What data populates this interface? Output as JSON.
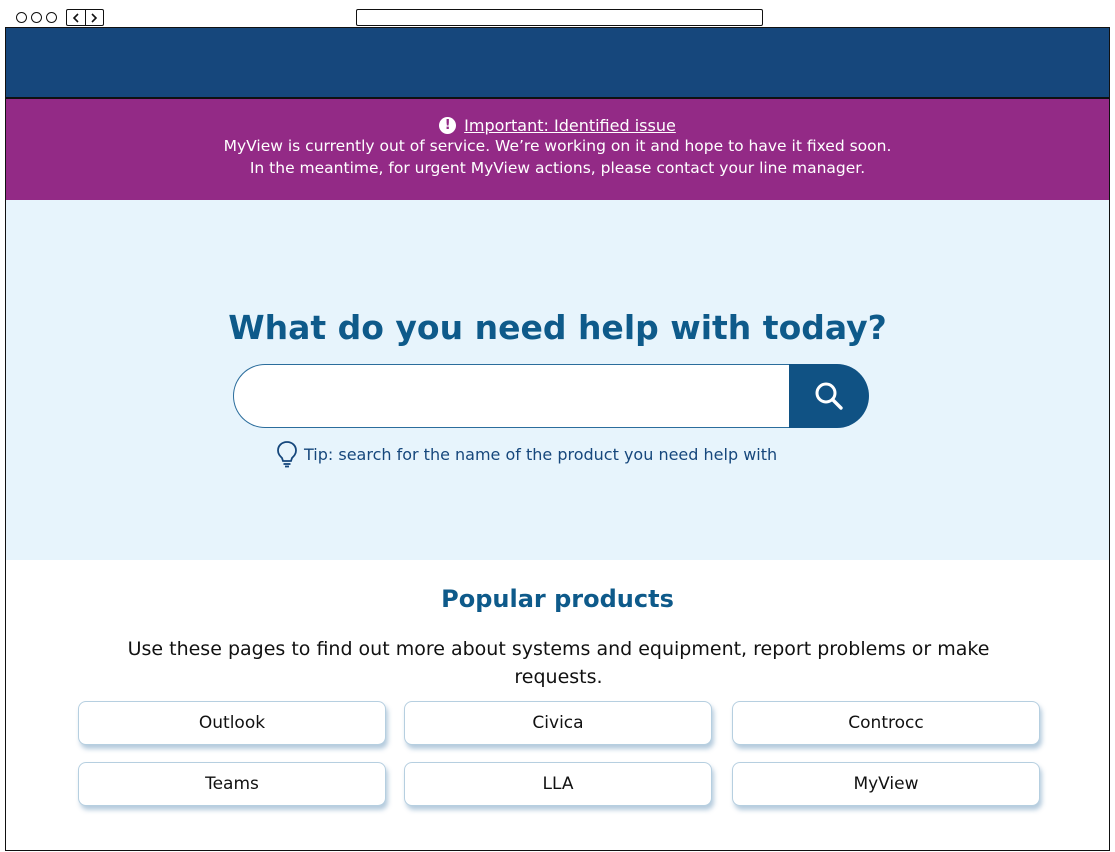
{
  "alert": {
    "title": "Important: Identified issue",
    "line1": "MyView is currently out of service. We’re working on it and hope to have it fixed soon.",
    "line2": "In the meantime, for urgent MyView actions, please contact your line manager."
  },
  "hero": {
    "title": "What do you need help with today?",
    "search_value": "",
    "tip": "Tip: search for the name of the product you need help with"
  },
  "popular": {
    "title": "Popular products",
    "description": "Use these pages to find out more about systems and equipment, report problems or make requests.",
    "products": [
      {
        "label": "Outlook"
      },
      {
        "label": "Civica"
      },
      {
        "label": "Controcc"
      },
      {
        "label": "Teams"
      },
      {
        "label": "LLA"
      },
      {
        "label": "MyView"
      }
    ]
  },
  "colors": {
    "header": "#16477c",
    "alert": "#932a86",
    "hero_bg": "#e7f4fc",
    "accent": "#0e5a8a",
    "search_button": "#105284"
  },
  "icons": {
    "alert": "exclamation-circle-icon",
    "search": "search-icon",
    "tip": "lightbulb-icon"
  }
}
